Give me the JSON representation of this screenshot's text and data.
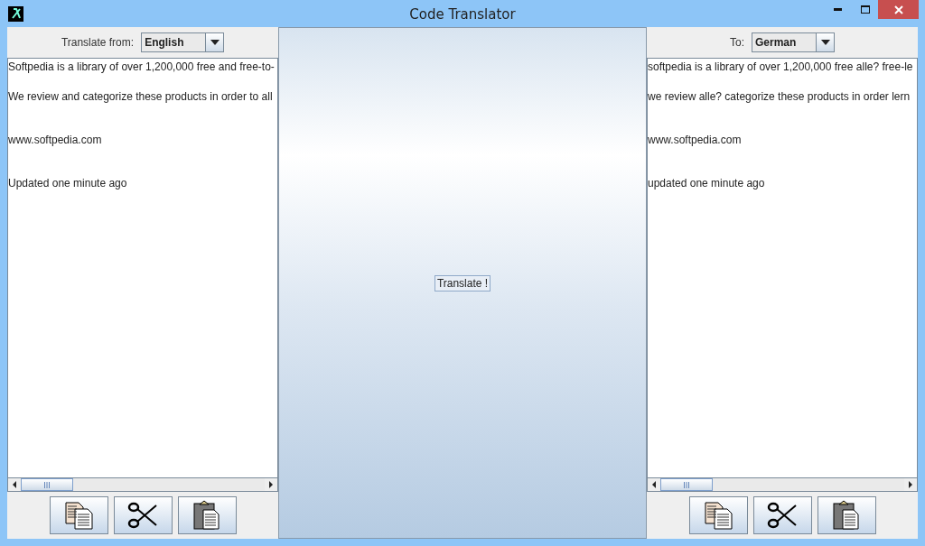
{
  "window": {
    "title": "Code Translator"
  },
  "source": {
    "label": "Translate from:",
    "language": "English",
    "lines": [
      "Softpedia is a library of over 1,200,000 free and free-to-",
      "We review and categorize these products in order to all",
      "www.softpedia.com",
      "Updated one minute ago"
    ]
  },
  "translate_button": "Translate !",
  "target": {
    "label": "To:",
    "language": "German",
    "lines": [
      "softpedia is a library of over 1,200,000 free alle? free-le",
      "we review alle? categorize these products in order lern",
      "www.softpedia.com",
      "updated one minute ago"
    ]
  }
}
